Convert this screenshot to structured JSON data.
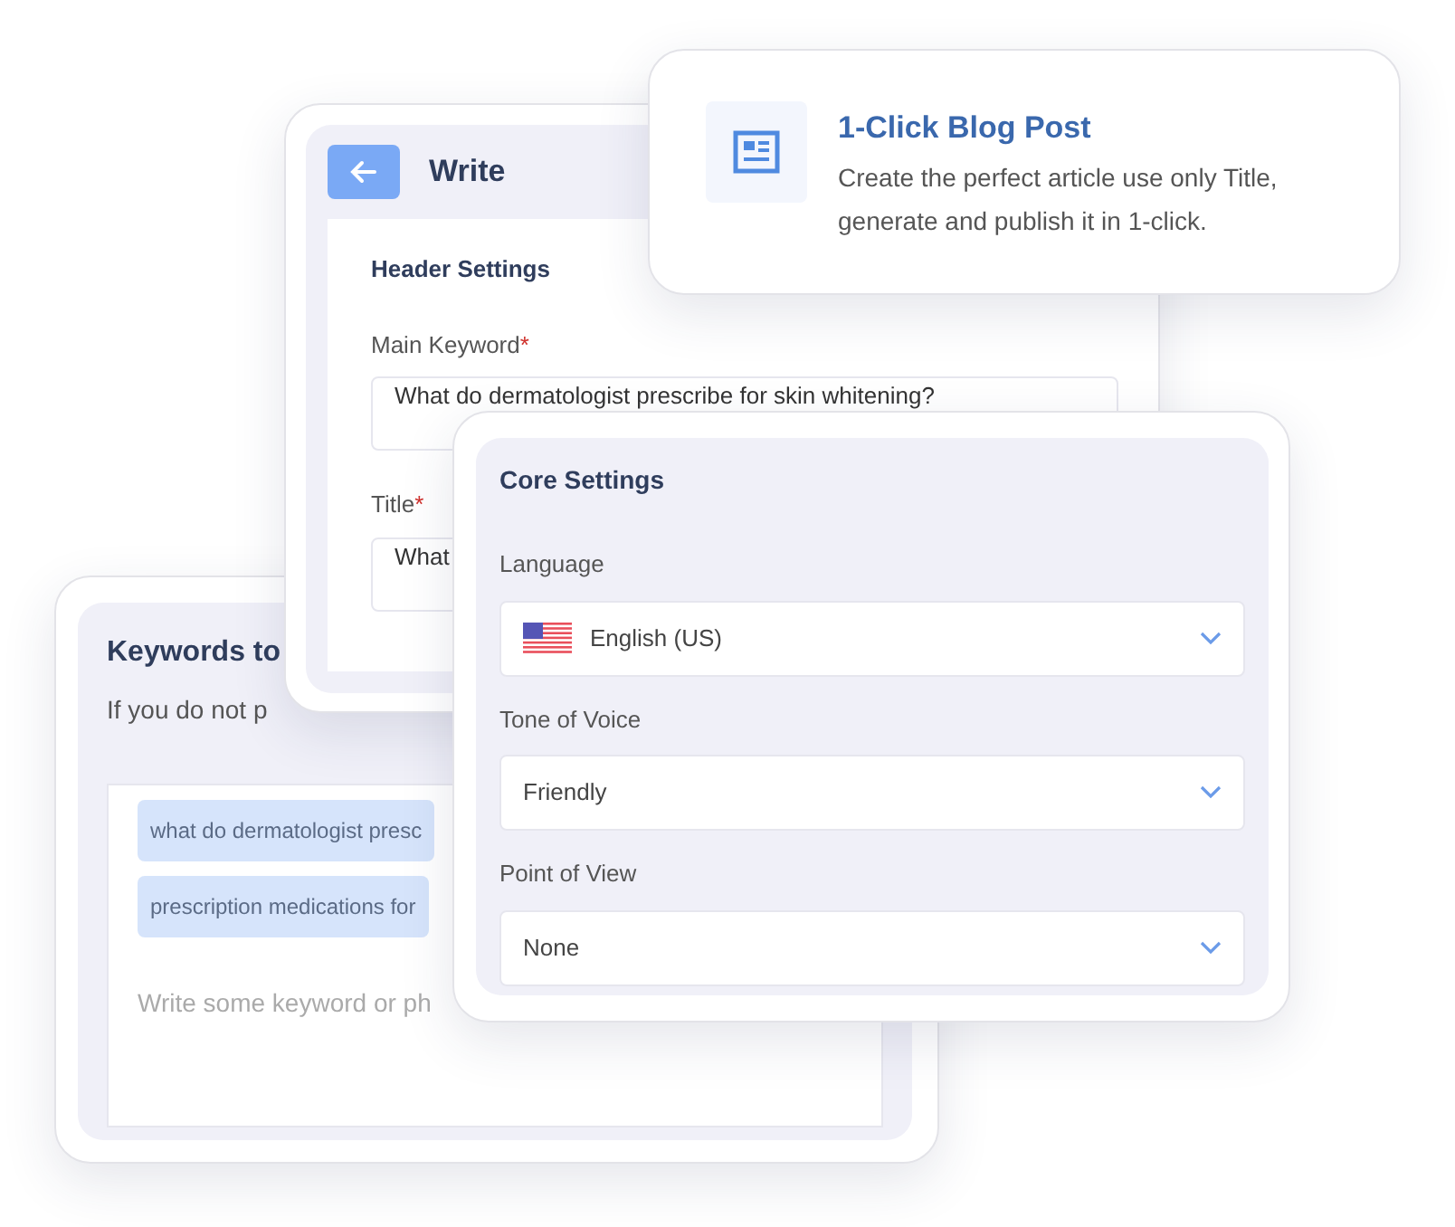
{
  "keywords_panel": {
    "title": "Keywords to",
    "description": "If you do not p",
    "keywords": [
      "what do dermatologist presc",
      "prescription medications for"
    ],
    "placeholder": "Write some keyword or ph"
  },
  "write_panel": {
    "title": "Write",
    "section_title": "Header Settings",
    "fields": [
      {
        "label": "Main Keyword",
        "required_mark": "*",
        "value": "What do dermatologist prescribe for skin whitening?"
      },
      {
        "label": "Title",
        "required_mark": "*",
        "value": "What"
      }
    ]
  },
  "core_settings": {
    "title": "Core Settings",
    "fields": [
      {
        "kind": "flag-select",
        "label": "Language",
        "value": "English (US)"
      },
      {
        "kind": "select",
        "label": "Tone of Voice",
        "value": "Friendly"
      },
      {
        "kind": "select",
        "label": "Point of View",
        "value": "None"
      }
    ]
  },
  "blog_post_card": {
    "title": "1-Click Blog Post",
    "description": "Create the perfect article use only Title, generate and publish it in 1-click."
  }
}
